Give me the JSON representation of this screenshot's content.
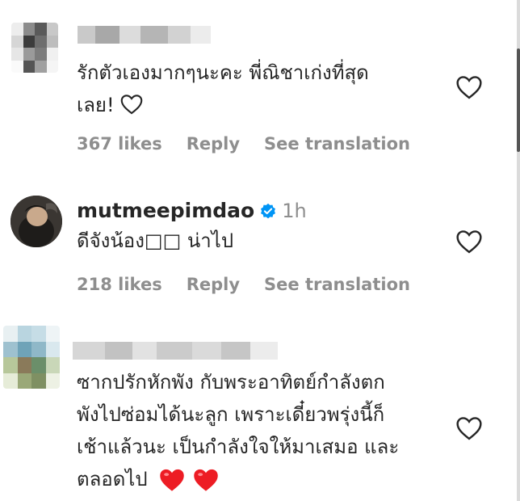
{
  "comments": [
    {
      "username_blurred": true,
      "text_lines": [
        "รักตัวเองมากๆนะคะ พี่ณิชาเก่งที่สุด",
        "เลย!"
      ],
      "likes": "367 likes",
      "reply": "Reply",
      "translate": "See translation"
    },
    {
      "username": "mutmeepimdao",
      "time": "1h",
      "text_lines": [
        "ดีจังน้อง□□ น่าไป"
      ],
      "likes": "218 likes",
      "reply": "Reply",
      "translate": "See translation"
    },
    {
      "username_blurred": true,
      "text_lines": [
        "ซากปรักหักพัง กับพระอาทิตย์กำลังตก",
        "พังไปซ่อมได้นะลูก เพราะเดี๋ยวพรุ่งนี้ก็",
        "เช้าแล้วนะ เป็นกำลังใจให้มาเสมอ และ",
        "ตลอดไป"
      ]
    }
  ],
  "colors": {
    "text": "#262626",
    "muted": "#8e8e8e",
    "verified": "#0095f6",
    "heart_red": "#ed1c24"
  },
  "icons": [
    "heart-outline-icon",
    "verified-badge-icon",
    "red-heart-emoji"
  ]
}
